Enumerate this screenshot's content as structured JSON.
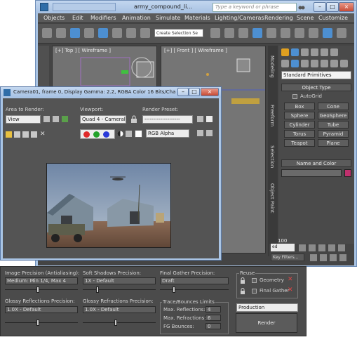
{
  "app": {
    "title": "army_compound_li...",
    "search_placeholder": "Type a keyword or phrase",
    "menu": [
      "Objects",
      "Edit",
      "Modifiers",
      "Animation",
      "Simulate",
      "Materials",
      "Lighting/Cameras",
      "Rendering",
      "Scene",
      "Customize"
    ],
    "selection_set": "Create Selection Se",
    "viewport_top_label": "[+] Top ] [ Wireframe ]",
    "viewport_front_label": "[+] [ Front ] [ Wireframe ]",
    "time_value": "ed",
    "frame_tick": "100",
    "key_filters": "Key Filters..."
  },
  "command_panel": {
    "side_tabs": [
      "Modeling",
      "Freeform",
      "Selection",
      "Object Paint"
    ],
    "primitive_dropdown": "Standard Primitives",
    "object_type_title": "Object Type",
    "autogrid_label": "AutoGrid",
    "buttons": [
      "Box",
      "Cone",
      "Sphere",
      "GeoSphere",
      "Cylinder",
      "Tube",
      "Torus",
      "Pyramid",
      "Teapot",
      "Plane"
    ],
    "name_color_title": "Name and Color",
    "swatch_color": "#c0306d"
  },
  "render_frame": {
    "title": "Camera01, frame 0, Display Gamma: 2.2, RGBA Color 16 Bits/Channel (1...",
    "area_label": "Area to Render:",
    "area_value": "View",
    "viewport_label": "Viewport:",
    "viewport_value": "Quad 4 - Cameral",
    "preset_label": "Render Preset:",
    "preset_value": "--------------------",
    "channel_value": "RGB Alpha"
  },
  "settings": {
    "image_precision_label": "Image Precision (Antialiasing):",
    "image_precision_value": "Medium: Min 1/4, Max 4",
    "soft_shadows_label": "Soft Shadows Precision:",
    "soft_shadows_value": "1X - Default",
    "final_gather_label": "Final Gather Precision:",
    "final_gather_value": "Draft",
    "glossy_refl_label": "Glossy Reflections Precision:",
    "glossy_refl_value": "1.0X - Default",
    "glossy_refr_label": "Glossy Refractions Precision:",
    "glossy_refr_value": "1.0X - Default",
    "trace_title": "Trace/Bounces Limits",
    "max_reflections_label": "Max. Reflections:",
    "max_reflections_value": "4",
    "max_refractions_label": "Max. Refractions:",
    "max_refractions_value": "6",
    "fg_bounces_label": "FG Bounces:",
    "fg_bounces_value": "0",
    "reuse_title": "Reuse",
    "geometry_label": "Geometry",
    "final_gather_reuse_label": "Final Gather",
    "mode_value": "Production",
    "render_label": "Render",
    "slider_levels": {
      "image_precision": 0.45,
      "soft_shadows": 0.2,
      "final_gather": 0.2,
      "glossy_reflections": 0.45,
      "glossy_refractions": 0.45
    }
  }
}
